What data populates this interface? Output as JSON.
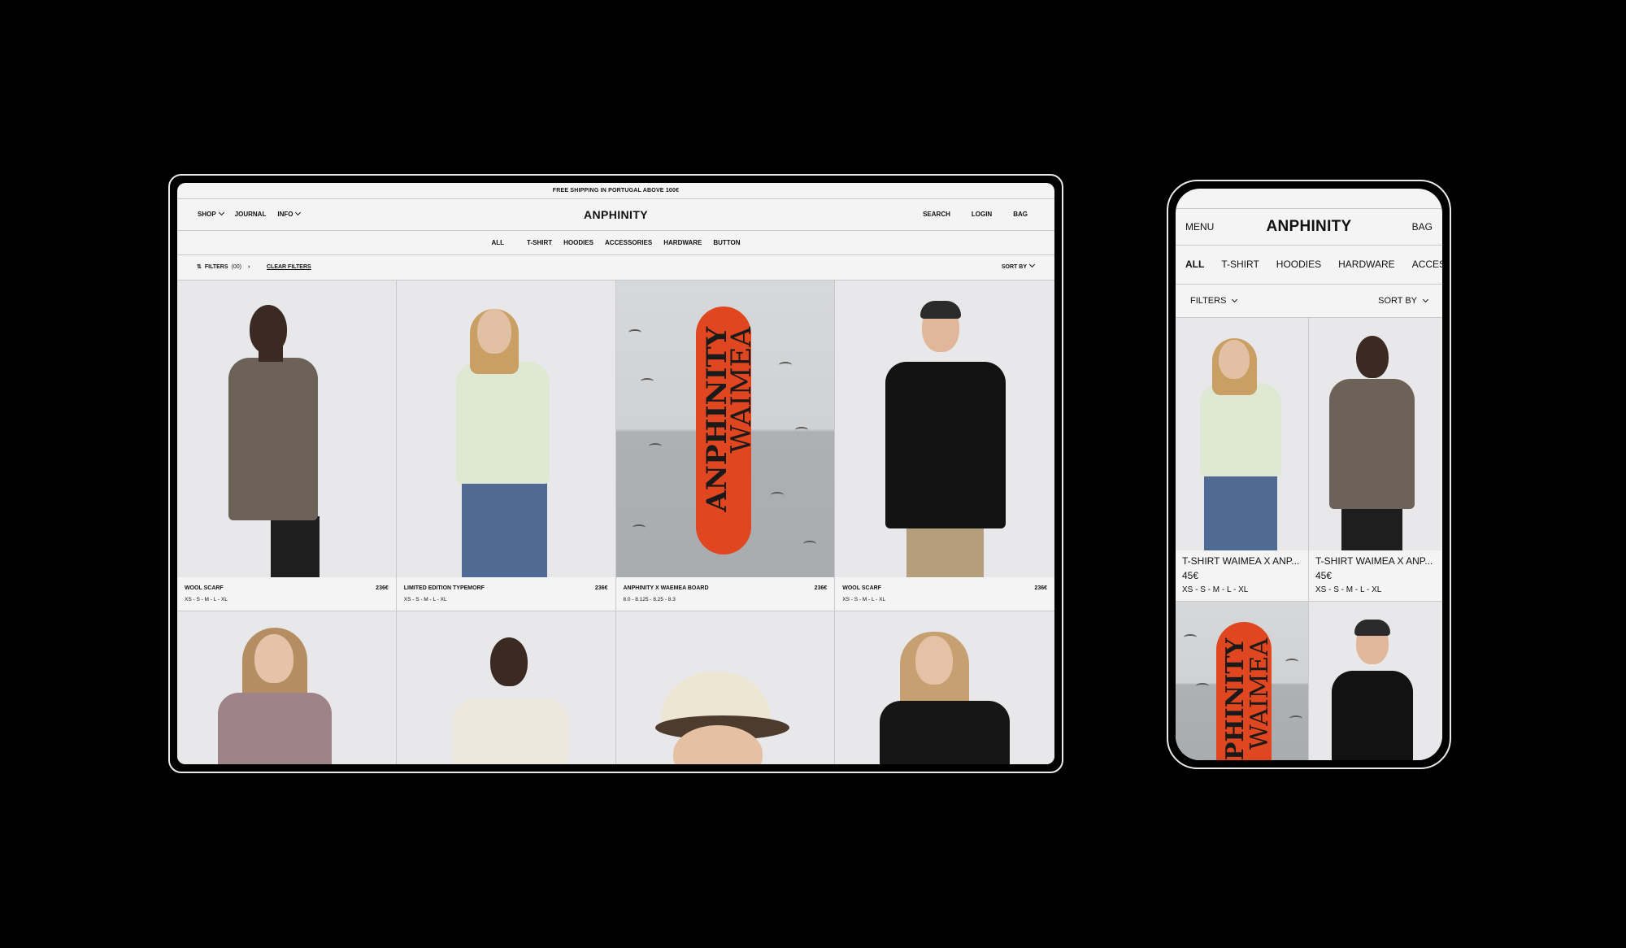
{
  "desktop": {
    "announcement": "FREE SHIPPING IN PORTUGAL ABOVE 100€",
    "nav_left": [
      "SHOP",
      "JOURNAL",
      "INFO"
    ],
    "logo": "ANPHINITY",
    "nav_right": [
      "SEARCH",
      "LOGIN",
      "BAG"
    ],
    "categories": [
      "ALL",
      "T-SHIRT",
      "HOODIES",
      "ACCESSORIES",
      "HARDWARE",
      "BUTTON"
    ],
    "filters_label": "FILTERS",
    "filters_count": "(00)",
    "clear_filters": "CLEAR FILTERS",
    "sort_by": "SORT BY",
    "products": [
      {
        "name": "WOOL SCARF",
        "price": "236€",
        "sizes": "XS - S - M - L - XL"
      },
      {
        "name": "LIMITED EDITION TYPEMORF",
        "price": "236€",
        "sizes": "XS - S - M - L - XL"
      },
      {
        "name": "ANPHINITY X WAEMEA BOARD",
        "price": "236€",
        "sizes": "8.0 - 8.125 - 8.25 - 8.3"
      },
      {
        "name": "WOOL SCARF",
        "price": "236€",
        "sizes": "XS - S - M - L - XL"
      }
    ],
    "board_text": [
      "ANPHINITY",
      "WAIMEA"
    ]
  },
  "mobile": {
    "menu": "MENU",
    "logo": "ANPHINITY",
    "bag": "BAG",
    "categories": [
      "ALL",
      "T-SHIRT",
      "HOODIES",
      "HARDWARE",
      "ACCESSORIES"
    ],
    "filters": "FILTERS",
    "sort_by": "SORT BY",
    "products": [
      {
        "name": "T-SHIRT WAIMEA X ANP...",
        "price": "45€",
        "sizes": "XS - S - M - L - XL"
      },
      {
        "name": "T-SHIRT WAIMEA X ANP...",
        "price": "45€",
        "sizes": "XS - S - M - L - XL"
      }
    ]
  }
}
